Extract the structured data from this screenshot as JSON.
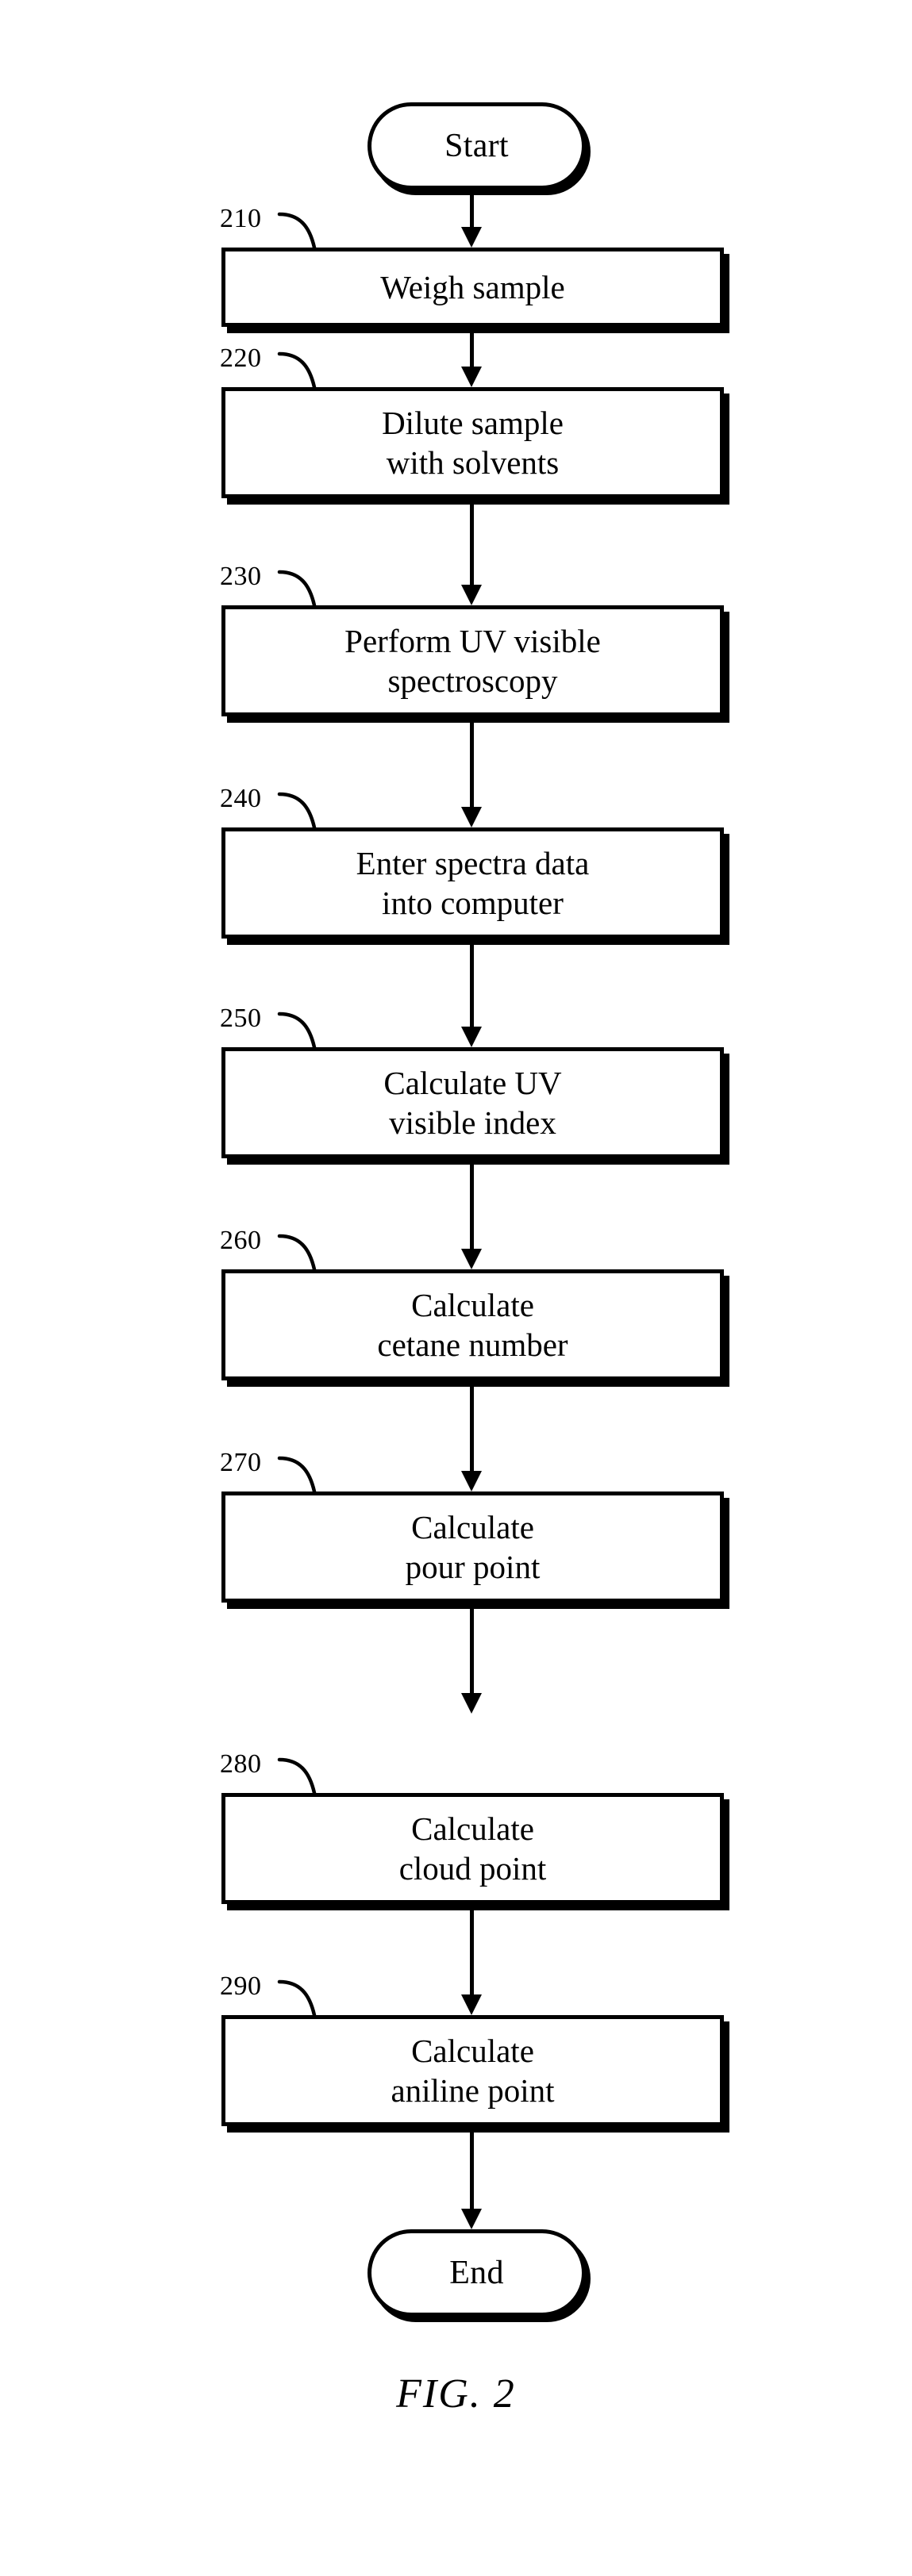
{
  "figure": {
    "caption": "FIG. 2",
    "type": "flowchart",
    "orientation": "vertical",
    "line_color": "#000000",
    "background_color": "#ffffff"
  },
  "nodes": [
    {
      "id": "start",
      "shape": "terminator",
      "label": "Start",
      "ref": ""
    },
    {
      "id": "step-210",
      "shape": "process",
      "label": "Weigh sample",
      "ref": "210"
    },
    {
      "id": "step-220",
      "shape": "process",
      "label": "Dilute sample\nwith solvents",
      "ref": "220"
    },
    {
      "id": "step-230",
      "shape": "process",
      "label": "Perform UV visible\nspectroscopy",
      "ref": "230"
    },
    {
      "id": "step-240",
      "shape": "process",
      "label": "Enter spectra data\ninto computer",
      "ref": "240"
    },
    {
      "id": "step-250",
      "shape": "process",
      "label": "Calculate UV\nvisible index",
      "ref": "250"
    },
    {
      "id": "step-260",
      "shape": "process",
      "label": "Calculate\ncetane number",
      "ref": "260"
    },
    {
      "id": "step-270",
      "shape": "process",
      "label": "Calculate\npour point",
      "ref": "270"
    },
    {
      "id": "step-280",
      "shape": "process",
      "label": "Calculate\ncloud point",
      "ref": "280"
    },
    {
      "id": "step-290",
      "shape": "process",
      "label": "Calculate\naniline point",
      "ref": "290"
    },
    {
      "id": "end",
      "shape": "terminator",
      "label": "End",
      "ref": ""
    }
  ]
}
